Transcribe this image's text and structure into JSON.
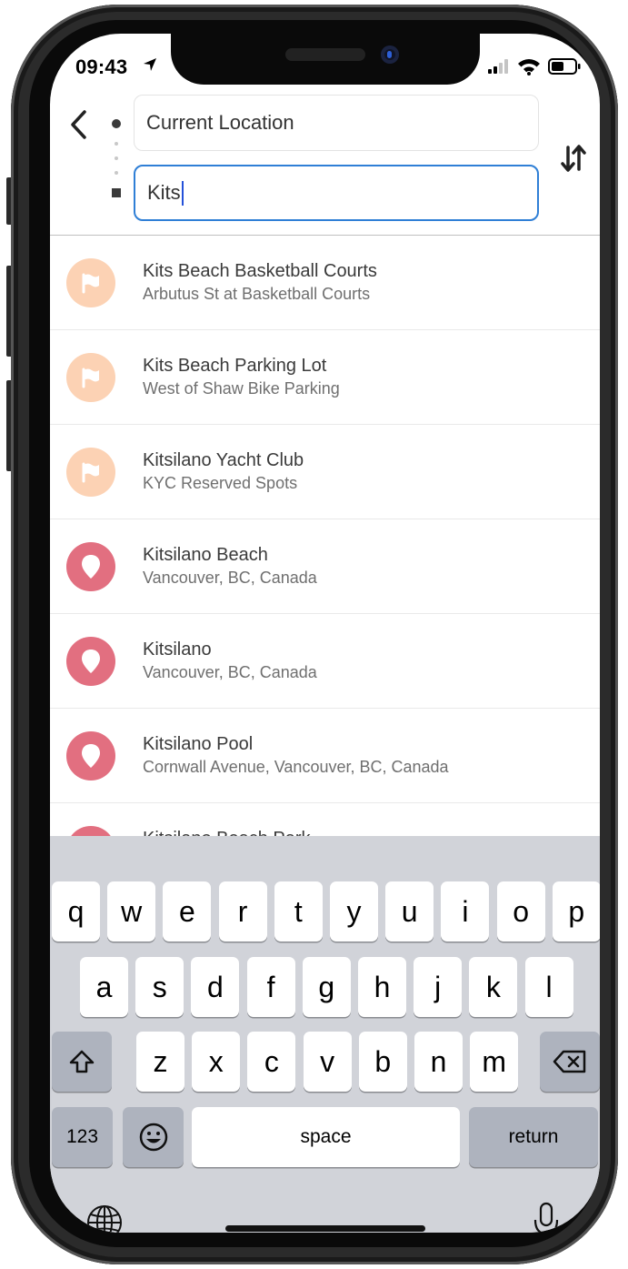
{
  "status_bar": {
    "time": "09:43"
  },
  "search": {
    "origin_value": "Current Location",
    "destination_value": "Kits"
  },
  "results": [
    {
      "icon": "flag-icon",
      "title": "Kits Beach Basketball Courts",
      "subtitle": "Arbutus St at Basketball Courts"
    },
    {
      "icon": "flag-icon",
      "title": "Kits Beach Parking Lot",
      "subtitle": "West of Shaw Bike Parking"
    },
    {
      "icon": "flag-icon",
      "title": "Kitsilano Yacht Club",
      "subtitle": "KYC Reserved Spots"
    },
    {
      "icon": "pin-icon",
      "title": "Kitsilano Beach",
      "subtitle": "Vancouver, BC, Canada"
    },
    {
      "icon": "pin-icon",
      "title": "Kitsilano",
      "subtitle": "Vancouver, BC, Canada"
    },
    {
      "icon": "pin-icon",
      "title": "Kitsilano Pool",
      "subtitle": "Cornwall Avenue, Vancouver, BC, Canada"
    },
    {
      "icon": "pin-icon",
      "title": "Kitsilano Beach Park",
      "subtitle": ""
    }
  ],
  "keyboard": {
    "row1": [
      "q",
      "w",
      "e",
      "r",
      "t",
      "y",
      "u",
      "i",
      "o",
      "p"
    ],
    "row2": [
      "a",
      "s",
      "d",
      "f",
      "g",
      "h",
      "j",
      "k",
      "l"
    ],
    "row3": [
      "z",
      "x",
      "c",
      "v",
      "b",
      "n",
      "m"
    ],
    "numbers_label": "123",
    "space_label": "space",
    "return_label": "return"
  },
  "colors": {
    "flag_bg": "#fcd2b4",
    "pin_bg": "#e26f80",
    "input_focus": "#2f7fd6"
  }
}
